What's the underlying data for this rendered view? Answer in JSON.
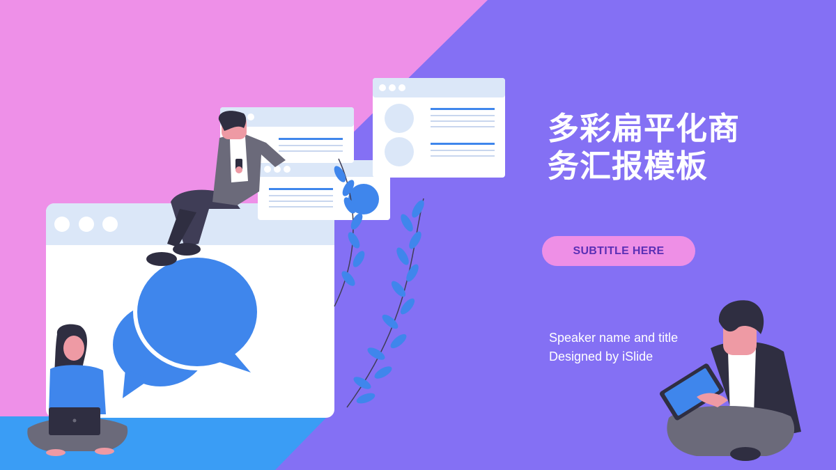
{
  "slide": {
    "title_line1": "多彩扁平化商",
    "title_line2": "务汇报模板",
    "subtitle": "SUBTITLE HERE",
    "speaker_line": "Speaker name and title",
    "designer_line": "Designed by iSlide"
  },
  "colors": {
    "background_purple": "#8470f4",
    "background_pink": "#ee90e8",
    "accent_blue": "#3a9df5",
    "bubble_blue": "#3f86ec",
    "window_header": "#dbe7f8",
    "subtitle_pill": "#ee8fe6",
    "subtitle_text": "#5a2fb5"
  }
}
